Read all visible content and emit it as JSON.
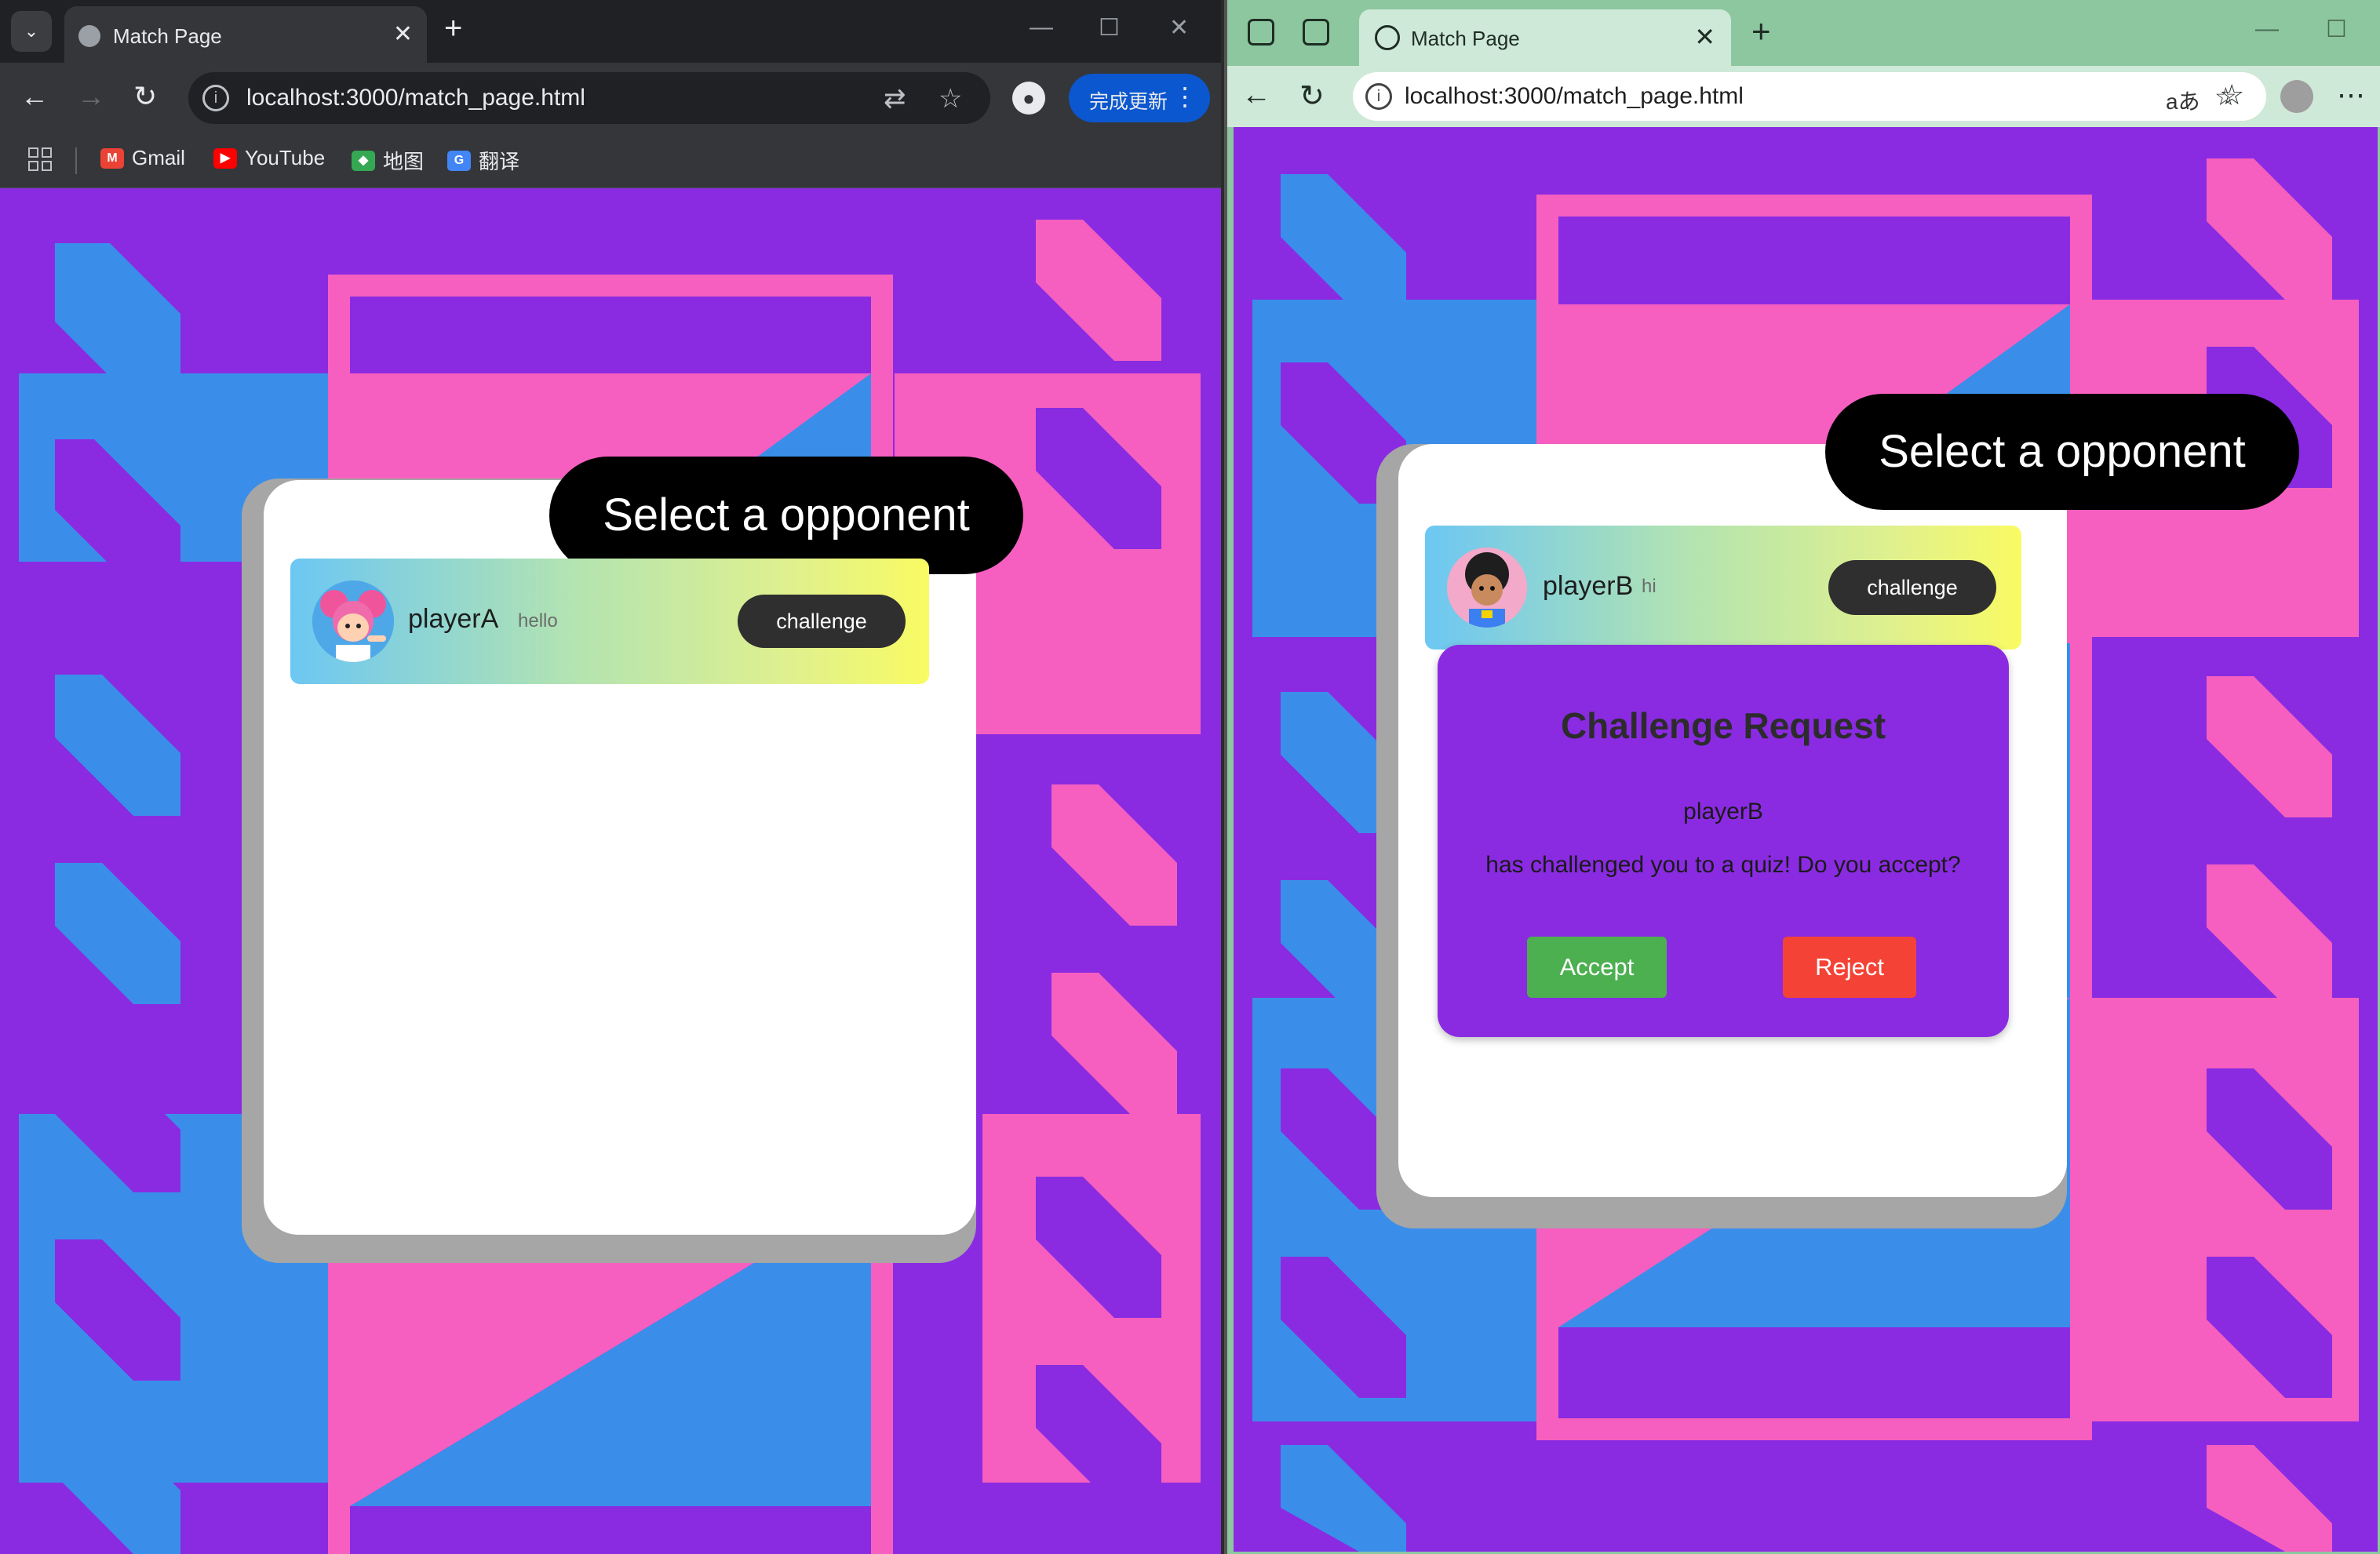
{
  "chrome_window": {
    "tab_title": "Match Page",
    "url": "localhost:3000/match_page.html",
    "update_button_label": "完成更新",
    "bookmarks": [
      "Gmail",
      "YouTube",
      "地图",
      "翻译"
    ],
    "page": {
      "select_title": "Select a opponent",
      "players": [
        {
          "name": "playerA",
          "status": "hello",
          "button_label": "challenge",
          "avatar": "pink-hair-character-avatar"
        }
      ]
    }
  },
  "edge_window": {
    "tab_title": "Match Page",
    "url": "localhost:3000/match_page.html",
    "page": {
      "select_title": "Select a opponent",
      "players": [
        {
          "name": "playerB",
          "status": "hi",
          "button_label": "challenge",
          "avatar": "curly-hair-character-avatar"
        }
      ],
      "dialog": {
        "title": "Challenge Request",
        "challenger": "playerB",
        "message": "has challenged you to a quiz! Do you accept?",
        "accept_label": "Accept",
        "reject_label": "Reject",
        "accept_color": "#4caf50",
        "reject_color": "#f44336"
      }
    }
  },
  "colors": {
    "purple": "#8a2be2",
    "blue": "#3a8eea",
    "pink": "#f65fbf"
  }
}
